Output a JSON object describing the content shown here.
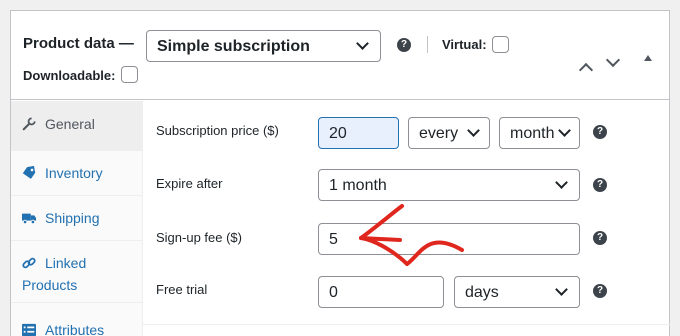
{
  "header": {
    "title": "Product data —",
    "product_type": "Simple subscription",
    "virtual_label": "Virtual:",
    "downloadable_label": "Downloadable:"
  },
  "sidebar": {
    "items": [
      {
        "label": "General",
        "icon": "wrench-icon",
        "active": true
      },
      {
        "label": "Inventory",
        "icon": "tag-icon",
        "active": false
      },
      {
        "label": "Shipping",
        "icon": "truck-icon",
        "active": false
      },
      {
        "label": "Linked",
        "label2": "Products",
        "icon": "link-icon",
        "active": false
      },
      {
        "label": "Attributes",
        "icon": "list-icon",
        "active": false
      }
    ]
  },
  "form": {
    "subscription_price": {
      "label": "Subscription price ($)",
      "value": "20",
      "period": "every",
      "interval": "month"
    },
    "expire_after": {
      "label": "Expire after",
      "value": "1 month"
    },
    "signup_fee": {
      "label": "Sign-up fee ($)",
      "value": "5"
    },
    "free_trial": {
      "label": "Free trial",
      "value": "0",
      "unit": "days"
    }
  },
  "help_glyph": "?",
  "colors": {
    "link": "#2271b1",
    "annotation": "#e0271e",
    "focus_bg": "#e8f0fe"
  }
}
